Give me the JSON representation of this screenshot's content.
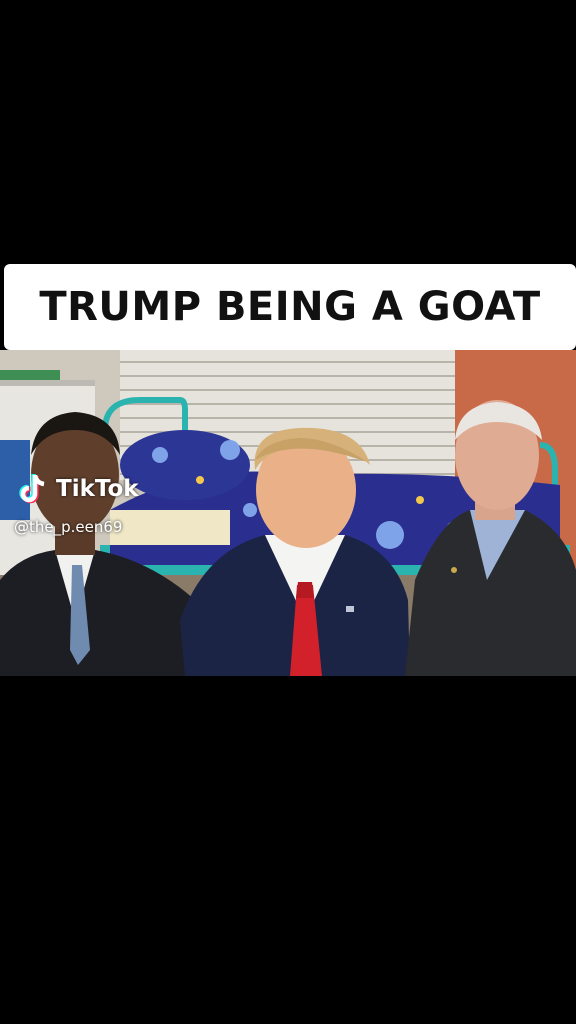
{
  "caption": {
    "text": "TRUMP BEING A GOAT"
  },
  "watermark": {
    "brand": "TikTok",
    "handle": "@the_p.een69"
  },
  "colors": {
    "background": "#000000",
    "caption_bg": "#ffffff",
    "caption_text": "#111111"
  }
}
